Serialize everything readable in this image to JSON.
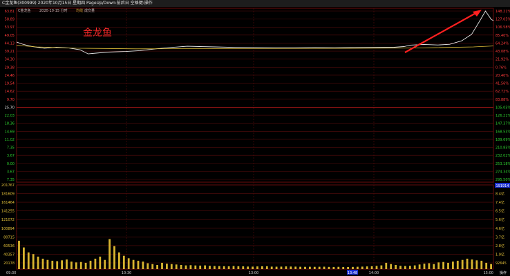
{
  "window": {
    "title": "C金龙鱼(300999)  2020年10月15日 星期四 PageUp/Down:前后日 空格键:操作"
  },
  "header": {
    "stock_label": "C金龙鱼",
    "date_label": "2020-10-15 分时",
    "line_label": "均线",
    "vol_label": "成交量"
  },
  "annotation": {
    "text": "金龙鱼"
  },
  "price_axis": {
    "left_ticks": [
      "63.81",
      "58.89",
      "53.97",
      "49.05",
      "44.13",
      "39.21",
      "34.30",
      "29.38",
      "24.46",
      "19.54",
      "14.62",
      "9.70",
      "25.70",
      "22.03",
      "18.36",
      "14.69",
      "11.02",
      "7.35",
      "3.67",
      "0.00",
      "3.67",
      "7.35"
    ],
    "left_colors": [
      "#ff3b3b",
      "#ff3b3b",
      "#ff3b3b",
      "#ff3b3b",
      "#ff3b3b",
      "#ff3b3b",
      "#ff3b3b",
      "#ff3b3b",
      "#ff3b3b",
      "#ff3b3b",
      "#ff3b3b",
      "#ff3b3b",
      "#e6e6e6",
      "#2fd12f",
      "#2fd12f",
      "#2fd12f",
      "#2fd12f",
      "#2fd12f",
      "#2fd12f",
      "#2fd12f",
      "#2fd12f",
      "#2fd12f"
    ],
    "right_ticks": [
      "148.21%",
      "127.05%",
      "106.58%",
      "85.40%",
      "64.24%",
      "43.08%",
      "21.92%",
      "0.76%",
      "20.40%",
      "41.56%",
      "62.72%",
      "83.88%",
      "105.05%",
      "126.21%",
      "147.37%",
      "168.53%",
      "189.69%",
      "210.85%",
      "232.02%",
      "253.18%",
      "274.34%",
      "295.50%"
    ],
    "right_colors": [
      "#ff3b3b",
      "#ff3b3b",
      "#ff3b3b",
      "#ff3b3b",
      "#ff3b3b",
      "#ff3b3b",
      "#ff3b3b",
      "#ff3b3b",
      "#ff3b3b",
      "#ff3b3b",
      "#ff3b3b",
      "#ff3b3b",
      "#2fd12f",
      "#2fd12f",
      "#2fd12f",
      "#2fd12f",
      "#2fd12f",
      "#2fd12f",
      "#2fd12f",
      "#2fd12f",
      "#2fd12f",
      "#2fd12f"
    ]
  },
  "volume_axis": {
    "left_ticks": [
      "201767",
      "181609",
      "161464",
      "141255",
      "121072",
      "100894",
      "80715",
      "60536",
      "40357",
      "20178"
    ],
    "right_ticks": [
      "9.4亿",
      "8.4亿",
      "7.4亿",
      "6.5亿",
      "5.6亿",
      "4.6亿",
      "3.7亿",
      "2.8亿",
      "1.9亿",
      "92645"
    ],
    "highlight_left": "191914"
  },
  "time_axis": {
    "labels": [
      "09:30",
      "10:30",
      "13:00",
      "14:00",
      "15:00"
    ],
    "cursor_label": "13:48"
  },
  "corner": {
    "label": "操作"
  },
  "chart_data": {
    "type": "line",
    "title": "C金龙鱼(300999) 2020-10-15 分时",
    "xlabel": "",
    "ylabel": "",
    "x_range": [
      0,
      240
    ],
    "ylim": [
      -7.35,
      63.81
    ],
    "series": [
      {
        "name": "分时",
        "color": "#e8e8e8",
        "points": [
          [
            0,
            44.8
          ],
          [
            3,
            43.5
          ],
          [
            8,
            42.0
          ],
          [
            14,
            41.0
          ],
          [
            20,
            41.6
          ],
          [
            26,
            41.2
          ],
          [
            32,
            40.0
          ],
          [
            36,
            37.5
          ],
          [
            40,
            38.0
          ],
          [
            46,
            38.6
          ],
          [
            55,
            39.0
          ],
          [
            62,
            39.5
          ],
          [
            70,
            40.6
          ],
          [
            78,
            41.5
          ],
          [
            86,
            42.2
          ],
          [
            92,
            42.0
          ],
          [
            100,
            41.8
          ],
          [
            110,
            41.5
          ],
          [
            120,
            41.4
          ],
          [
            130,
            41.3
          ],
          [
            140,
            41.3
          ],
          [
            150,
            41.4
          ],
          [
            160,
            41.3
          ],
          [
            170,
            41.4
          ],
          [
            180,
            41.5
          ],
          [
            190,
            41.6
          ],
          [
            195,
            42.0
          ],
          [
            198,
            42.9
          ],
          [
            205,
            43.3
          ],
          [
            212,
            43.0
          ],
          [
            218,
            43.4
          ],
          [
            224,
            45.5
          ],
          [
            229,
            49.5
          ],
          [
            233,
            57.5
          ],
          [
            236,
            63.8
          ],
          [
            239,
            58.5
          ],
          [
            240,
            58.0
          ]
        ]
      },
      {
        "name": "均线",
        "color": "#e5c23a",
        "points": [
          [
            0,
            42.8
          ],
          [
            10,
            41.8
          ],
          [
            30,
            41.0
          ],
          [
            60,
            40.6
          ],
          [
            100,
            40.8
          ],
          [
            150,
            40.9
          ],
          [
            200,
            41.1
          ],
          [
            230,
            41.8
          ],
          [
            240,
            42.4
          ]
        ]
      }
    ],
    "volume": {
      "ylim": [
        0,
        201767
      ],
      "values": [
        68000,
        52000,
        40000,
        36000,
        30000,
        25000,
        22000,
        20000,
        19000,
        21000,
        23000,
        18000,
        16000,
        17000,
        15000,
        20000,
        25000,
        30000,
        22000,
        72000,
        55000,
        40000,
        32000,
        26000,
        22000,
        20000,
        18000,
        14000,
        12000,
        10000,
        15000,
        13000,
        12000,
        11000,
        10000,
        9000,
        9500,
        8800,
        8500,
        9000,
        8000,
        7500,
        7200,
        7000,
        6800,
        7500,
        7000,
        6600,
        6200,
        6000,
        6500,
        6800,
        7000,
        6000,
        5800,
        6000,
        6400,
        6200,
        5900,
        5700,
        5500,
        5600,
        5400,
        5600,
        5800,
        5300,
        5200,
        5400,
        5100,
        5000,
        5300,
        5600,
        5900,
        6500,
        7000,
        7800,
        9000,
        15000,
        12000,
        10000,
        8000,
        7500,
        8000,
        9000,
        11000,
        13000,
        14000,
        12000,
        16000,
        17000,
        15000,
        18000,
        20000,
        22000,
        25000,
        23000,
        21000,
        20000,
        15000,
        12000
      ]
    },
    "grid": true,
    "legend": "top-left"
  }
}
